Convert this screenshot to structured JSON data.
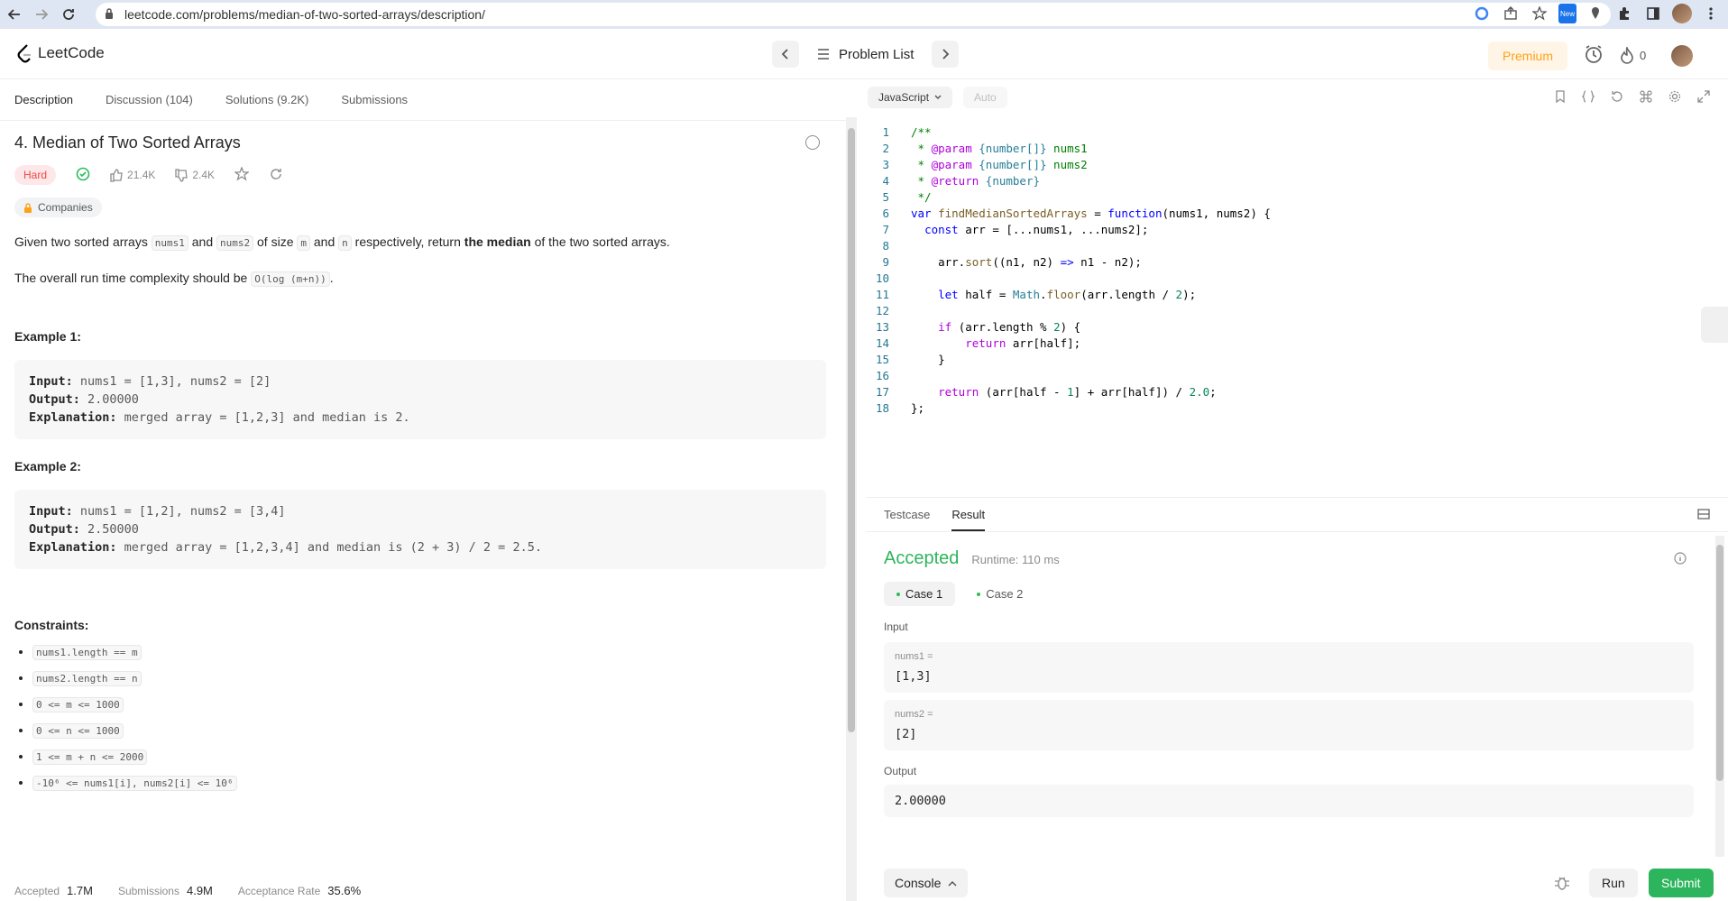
{
  "browser": {
    "url": "leetcode.com/problems/median-of-two-sorted-arrays/description/",
    "extension_badge": "New"
  },
  "appbar": {
    "logo": "LeetCode",
    "problem_list": "Problem List",
    "premium": "Premium",
    "streak_count": "0"
  },
  "tabs": [
    {
      "label": "Description"
    },
    {
      "label": "Discussion (104)"
    },
    {
      "label": "Solutions (9.2K)"
    },
    {
      "label": "Submissions"
    }
  ],
  "problem": {
    "title": "4. Median of Two Sorted Arrays",
    "difficulty": "Hard",
    "likes": "21.4K",
    "dislikes": "2.4K",
    "companies": "Companies",
    "desc": {
      "p1_a": "Given two sorted arrays ",
      "nums1": "nums1",
      "and": " and ",
      "nums2": "nums2",
      "p1_b": " of size ",
      "m": "m",
      "and2": " and ",
      "n": "n",
      "p1_c": " respectively, return ",
      "median": "the median",
      "p1_d": " of the two sorted arrays.",
      "p2_a": "The overall run time complexity should be ",
      "complexity": "O(log (m+n))",
      "p2_b": "."
    },
    "examples": [
      {
        "title": "Example 1:",
        "input_label": "Input:",
        "input": " nums1 = [1,3], nums2 = [2]",
        "output_label": "Output:",
        "output": " 2.00000",
        "expl_label": "Explanation:",
        "expl": " merged array = [1,2,3] and median is 2."
      },
      {
        "title": "Example 2:",
        "input_label": "Input:",
        "input": " nums1 = [1,2], nums2 = [3,4]",
        "output_label": "Output:",
        "output": " 2.50000",
        "expl_label": "Explanation:",
        "expl": " merged array = [1,2,3,4] and median is (2 + 3) / 2 = 2.5."
      }
    ],
    "constraints_title": "Constraints:",
    "constraints": [
      "nums1.length == m",
      "nums2.length == n",
      "0 <= m <= 1000",
      "0 <= n <= 1000",
      "1 <= m + n <= 2000",
      "-10⁶ <= nums1[i], nums2[i] <= 10⁶"
    ],
    "stats": {
      "accepted_label": "Accepted",
      "accepted": "1.7M",
      "submissions_label": "Submissions",
      "submissions": "4.9M",
      "rate_label": "Acceptance Rate",
      "rate": "35.6%"
    }
  },
  "editor": {
    "language": "JavaScript",
    "auto": "Auto"
  },
  "result": {
    "tabs": [
      "Testcase",
      "Result"
    ],
    "status": "Accepted",
    "runtime": "Runtime: 110 ms",
    "cases": [
      "Case 1",
      "Case 2"
    ],
    "input_label": "Input",
    "fields": [
      {
        "name": "nums1 =",
        "value": "[1,3]"
      },
      {
        "name": "nums2 =",
        "value": "[2]"
      }
    ],
    "output_label": "Output",
    "output": "2.00000"
  },
  "bottom": {
    "console": "Console",
    "run": "Run",
    "submit": "Submit"
  }
}
